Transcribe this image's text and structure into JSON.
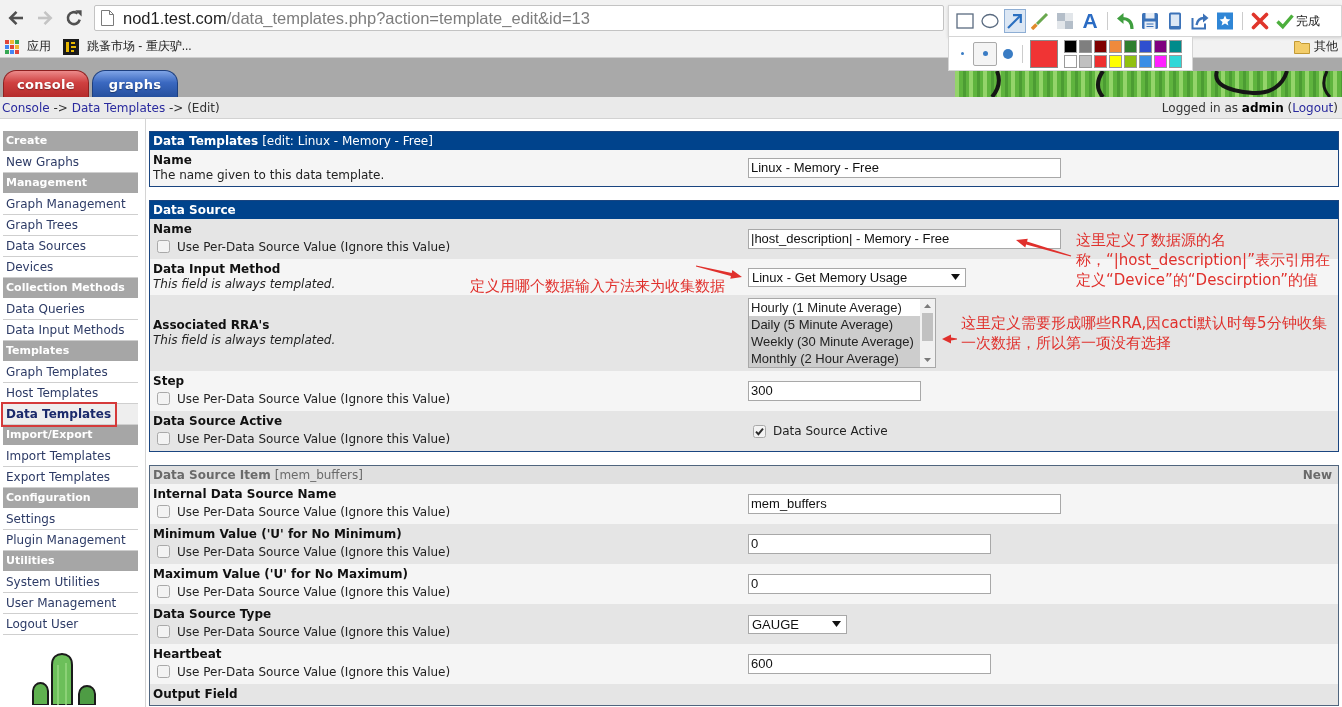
{
  "browser": {
    "nav": [
      {
        "kind": "back",
        "disabled": false
      },
      {
        "kind": "forward",
        "disabled": true
      },
      {
        "kind": "reload",
        "disabled": false
      }
    ],
    "url": {
      "host": "nod1.test.com",
      "path": "/data_templates.php?action=template_edit&id=13"
    },
    "bookmarks": [
      {
        "kind": "apps",
        "label": "应用"
      },
      {
        "kind": "site",
        "label": "跳蚤市场 - 重庆驴..."
      }
    ],
    "other_bookmarks": {
      "label": "其他"
    }
  },
  "capture_toolbar": {
    "tools": [
      {
        "kind": "rectangle",
        "selected": false
      },
      {
        "kind": "ellipse",
        "selected": false
      },
      {
        "kind": "arrow",
        "selected": true
      },
      {
        "kind": "pen",
        "selected": false
      },
      {
        "kind": "mosaic",
        "selected": false
      },
      {
        "kind": "text",
        "label": "A",
        "selected": false
      }
    ],
    "actions": [
      {
        "kind": "undo"
      },
      {
        "kind": "save"
      },
      {
        "kind": "device"
      },
      {
        "kind": "share"
      },
      {
        "kind": "favorite"
      }
    ],
    "finish": [
      {
        "kind": "cancel"
      },
      {
        "kind": "done",
        "label": "完成"
      }
    ],
    "sizes": [
      {
        "kind": "small",
        "selected": false
      },
      {
        "kind": "medium",
        "selected": true
      },
      {
        "kind": "large",
        "selected": false
      }
    ],
    "current": {
      "color": "#f03434"
    },
    "palette": [
      {
        "color": "#000000"
      },
      {
        "color": "#7f7f7f"
      },
      {
        "color": "#7f0000"
      },
      {
        "color": "#ef8a3c"
      },
      {
        "color": "#2f7f2f"
      },
      {
        "color": "#2f4fcf"
      },
      {
        "color": "#7f007f"
      },
      {
        "color": "#008b8b"
      },
      {
        "color": "#ffffff"
      },
      {
        "color": "#c0c0c0"
      },
      {
        "color": "#ee3030"
      },
      {
        "color": "#ffff00"
      },
      {
        "color": "#90c010"
      },
      {
        "color": "#3a8ee6"
      },
      {
        "color": "#ff20ff"
      },
      {
        "color": "#30d8d8"
      }
    ]
  },
  "tabs": [
    {
      "label": "console",
      "selected": true
    },
    {
      "label": "graphs",
      "selected": false
    }
  ],
  "breadcrumb": [
    {
      "text": "Console",
      "link": true
    },
    {
      "text": " -> ",
      "link": false
    },
    {
      "text": "Data Templates",
      "link": true
    },
    {
      "text": " -> (Edit)",
      "link": false
    }
  ],
  "login": {
    "text": "Logged in as **admin** (",
    "link": "Logout",
    "after": ")"
  },
  "sidebar": [
    {
      "title": "Create",
      "items": [
        {
          "label": "New Graphs",
          "selected": false,
          "outlined": false
        }
      ]
    },
    {
      "title": "Management",
      "items": [
        {
          "label": "Graph Management",
          "selected": false,
          "outlined": false
        },
        {
          "label": "Graph Trees",
          "selected": false,
          "outlined": false
        },
        {
          "label": "Data Sources",
          "selected": false,
          "outlined": false
        },
        {
          "label": "Devices",
          "selected": false,
          "outlined": false
        }
      ]
    },
    {
      "title": "Collection Methods",
      "items": [
        {
          "label": "Data Queries",
          "selected": false,
          "outlined": false
        },
        {
          "label": "Data Input Methods",
          "selected": false,
          "outlined": false
        }
      ]
    },
    {
      "title": "Templates",
      "items": [
        {
          "label": "Graph Templates",
          "selected": false,
          "outlined": false
        },
        {
          "label": "Host Templates",
          "selected": false,
          "outlined": false
        },
        {
          "label": "Data Templates",
          "selected": true,
          "outlined": true
        }
      ]
    },
    {
      "title": "Import/Export",
      "items": [
        {
          "label": "Import Templates",
          "selected": false,
          "outlined": false
        },
        {
          "label": "Export Templates",
          "selected": false,
          "outlined": false
        }
      ]
    },
    {
      "title": "Configuration",
      "items": [
        {
          "label": "Settings",
          "selected": false,
          "outlined": false
        },
        {
          "label": "Plugin Management",
          "selected": false,
          "outlined": false
        }
      ]
    },
    {
      "title": "Utilities",
      "items": [
        {
          "label": "System Utilities",
          "selected": false,
          "outlined": false
        },
        {
          "label": "User Management",
          "selected": false,
          "outlined": false
        },
        {
          "label": "Logout User",
          "selected": false,
          "outlined": false
        }
      ]
    }
  ],
  "panels": [
    {
      "dimmed": false,
      "title": "Data Templates",
      "subtitle": "[edit: Linux - Memory - Free]",
      "rows": [
        {
          "label": "Name",
          "note": {
            "kind": "description",
            "text": "The name given to this data template."
          },
          "control": {
            "kind": "longtext",
            "value": "Linux - Memory - Free"
          }
        }
      ]
    },
    {
      "dimmed": false,
      "title": "Data Source",
      "rows": [
        {
          "label": "Name",
          "note": {
            "kind": "checkbox",
            "checked": false,
            "text": "Use Per-Data Source Value (Ignore this Value)"
          },
          "control": {
            "kind": "longtext",
            "value": "|host_description| - Memory - Free"
          },
          "annotation": {
            "kind": "after",
            "text": "这里定义了数据源的名称，“|host_description|”表示引用在定义“Device”的“Descirption”的值"
          }
        },
        {
          "label": "Data Input Method",
          "note": {
            "kind": "templated",
            "text": "This field is always templated."
          },
          "control": {
            "kind": "select",
            "value": "Linux - Get Memory Usage"
          },
          "annotation": {
            "kind": "before",
            "text": "定义用哪个数据输入方法来为收集数据"
          }
        },
        {
          "label": "Associated RRA's",
          "note": {
            "kind": "templated",
            "text": "This field is always templated."
          },
          "control": {
            "kind": "listbox",
            "options": [
              {
                "label": "Hourly (1 Minute Average)",
                "selected": false
              },
              {
                "label": "Daily (5 Minute Average)",
                "selected": true
              },
              {
                "label": "Weekly (30 Minute Average)",
                "selected": true
              },
              {
                "label": "Monthly (2 Hour Average)",
                "selected": true
              }
            ]
          },
          "annotation": {
            "kind": "after",
            "text": "这里定义需要形成哪些RRA,因cacti默认时每5分钟收集一次数据，所以第一项没有选择"
          }
        },
        {
          "label": "Step",
          "note": {
            "kind": "checkbox",
            "checked": false,
            "text": "Use Per-Data Source Value (Ignore this Value)"
          },
          "control": {
            "kind": "shorttext",
            "value": "300"
          }
        },
        {
          "label": "Data Source Active",
          "note": {
            "kind": "checkbox",
            "checked": false,
            "text": "Use Per-Data Source Value (Ignore this Value)"
          },
          "control": {
            "kind": "checkbox",
            "checked": true,
            "label": "Data Source Active"
          }
        }
      ]
    },
    {
      "dimmed": true,
      "title": "Data Source Item",
      "subtitle": "[mem_buffers]",
      "action": "New",
      "rows": [
        {
          "label": "Internal Data Source Name",
          "note": {
            "kind": "checkbox",
            "checked": false,
            "text": "Use Per-Data Source Value (Ignore this Value)"
          },
          "control": {
            "kind": "longtext",
            "value": "mem_buffers"
          }
        },
        {
          "label": "Minimum Value ('U' for No Minimum)",
          "note": {
            "kind": "checkbox",
            "checked": false,
            "text": "Use Per-Data Source Value (Ignore this Value)"
          },
          "control": {
            "kind": "text",
            "value": "0"
          }
        },
        {
          "label": "Maximum Value ('U' for No Maximum)",
          "note": {
            "kind": "checkbox",
            "checked": false,
            "text": "Use Per-Data Source Value (Ignore this Value)"
          },
          "control": {
            "kind": "text",
            "value": "0"
          }
        },
        {
          "label": "Data Source Type",
          "note": {
            "kind": "checkbox",
            "checked": false,
            "text": "Use Per-Data Source Value (Ignore this Value)"
          },
          "control": {
            "kind": "shortselect",
            "value": "GAUGE"
          }
        },
        {
          "label": "Heartbeat",
          "note": {
            "kind": "checkbox",
            "checked": false,
            "text": "Use Per-Data Source Value (Ignore this Value)"
          },
          "control": {
            "kind": "text",
            "value": "600"
          }
        },
        {
          "label": "Output Field"
        }
      ]
    }
  ]
}
